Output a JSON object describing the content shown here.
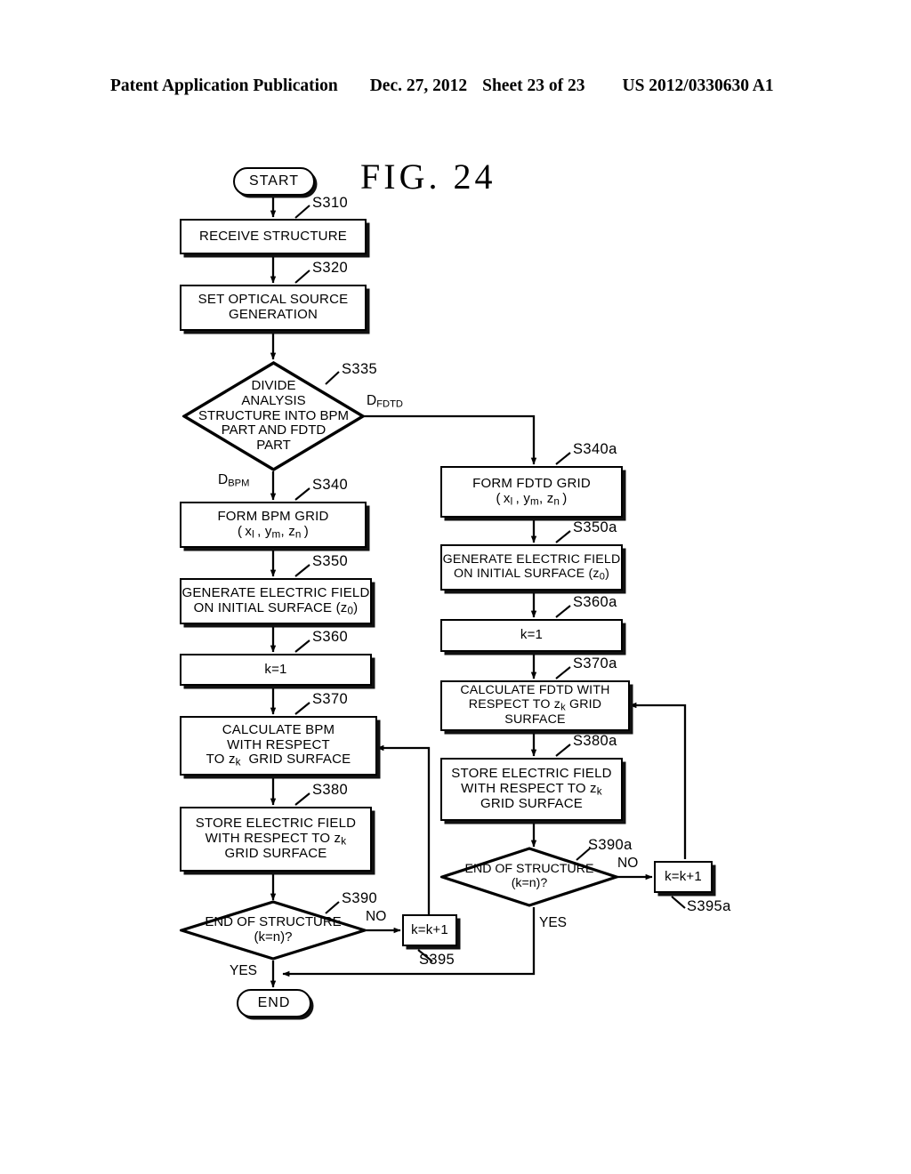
{
  "header": {
    "publication": "Patent Application Publication",
    "date": "Dec. 27, 2012",
    "sheet": "Sheet 23 of 23",
    "number": "US 2012/0330630 A1"
  },
  "figure": {
    "title": "FIG.  24"
  },
  "flowchart": {
    "type": "flowchart",
    "nodes": {
      "start": "START",
      "end": "END",
      "s310": "RECEIVE STRUCTURE",
      "s320": "SET OPTICAL SOURCE\nGENERATION",
      "s335": "DIVIDE\nANALYSIS\nSTRUCTURE INTO BPM\nPART AND FDTD\nPART",
      "s340": "FORM BPM GRID",
      "s340_sub": "( x l , y m , z n )",
      "s350": "GENERATE ELECTRIC FIELD\nON INITIAL SURFACE (z 0)",
      "s360": "k=1",
      "s370": "CALCULATE BPM\nWITH RESPECT\nTO z k  GRID SURFACE",
      "s380": "STORE ELECTRIC FIELD\nWITH RESPECT TO z k\nGRID SURFACE",
      "s390": "END OF STRUCTURE\n(k=n)?",
      "s395": "k=k+1",
      "s340a": "FORM FDTD GRID",
      "s340a_sub": "( x l , y m , z n )",
      "s350a": "GENERATE ELECTRIC FIELD\nON INITIAL SURFACE (z 0)",
      "s360a": "k=1",
      "s370a": "CALCULATE FDTD WITH\nRESPECT TO z k GRID SURFACE",
      "s380a": "STORE ELECTRIC FIELD\nWITH RESPECT TO z k\nGRID SURFACE",
      "s390a": "END OF STRUCTURE\n(k=n)?",
      "s395a": "k=k+1"
    },
    "step_labels": {
      "s310": "S310",
      "s320": "S320",
      "s335": "S335",
      "s340": "S340",
      "s350": "S350",
      "s360": "S360",
      "s370": "S370",
      "s380": "S380",
      "s390": "S390",
      "s395": "S395",
      "s340a": "S340a",
      "s350a": "S350a",
      "s360a": "S360a",
      "s370a": "S370a",
      "s380a": "S380a",
      "s390a": "S390a",
      "s395a": "S395a"
    },
    "edge_labels": {
      "d_fdtd_main": "D",
      "d_fdtd_sub": "FDTD",
      "d_bpm_main": "D",
      "d_bpm_sub": "BPM",
      "no_left": "NO",
      "yes_left": "YES",
      "no_right": "NO",
      "yes_right": "YES"
    }
  },
  "colors": {
    "ink": "#000000",
    "paper": "#ffffff"
  }
}
